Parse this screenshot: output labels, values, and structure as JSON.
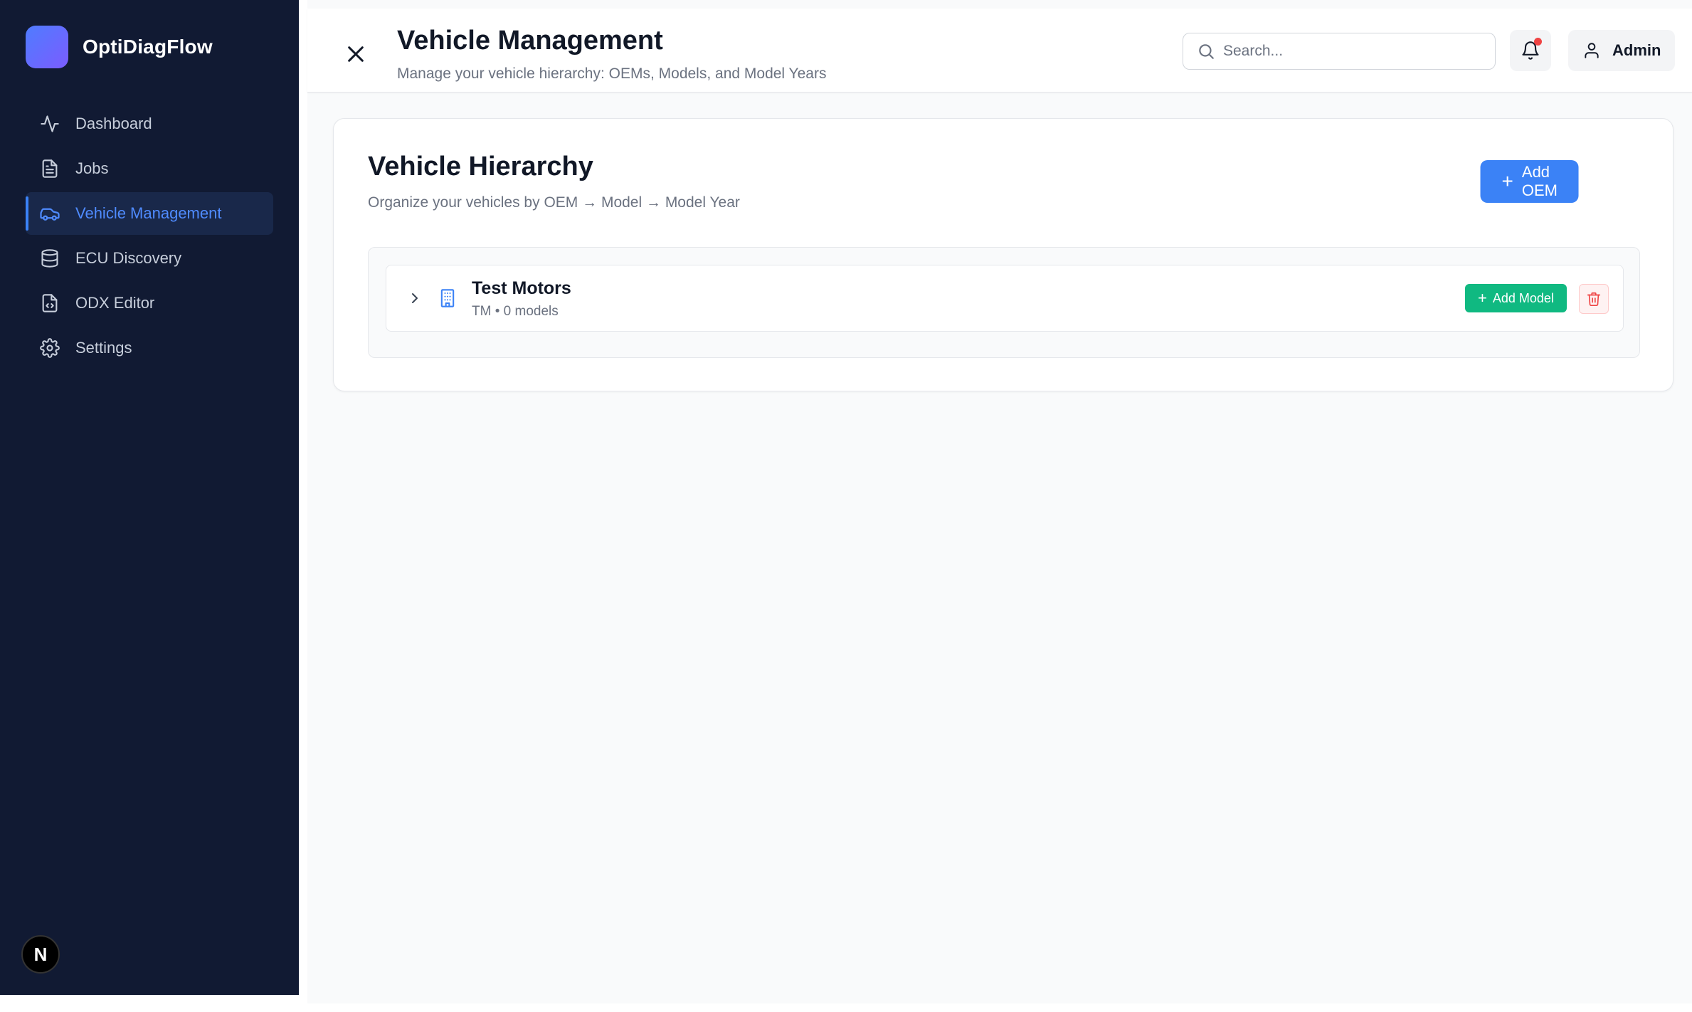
{
  "app": {
    "name": "OptiDiagFlow"
  },
  "sidebar": {
    "items": [
      {
        "label": "Dashboard",
        "icon": "activity-icon",
        "active": false
      },
      {
        "label": "Jobs",
        "icon": "file-text-icon",
        "active": false
      },
      {
        "label": "Vehicle Management",
        "icon": "car-icon",
        "active": true
      },
      {
        "label": "ECU Discovery",
        "icon": "database-icon",
        "active": false
      },
      {
        "label": "ODX Editor",
        "icon": "file-code-icon",
        "active": false
      },
      {
        "label": "Settings",
        "icon": "gear-icon",
        "active": false
      }
    ],
    "footer_badge": "N"
  },
  "header": {
    "title": "Vehicle Management",
    "subtitle": "Manage your vehicle hierarchy: OEMs, Models, and Model Years",
    "search_placeholder": "Search...",
    "user_label": "Admin",
    "has_notification": true
  },
  "hierarchy": {
    "title": "Vehicle Hierarchy",
    "subtitle": "Organize your vehicles by OEM → Model → Model Year",
    "add_oem_label": "Add OEM",
    "oems": [
      {
        "name": "Test Motors",
        "meta": "TM • 0 models",
        "add_model_label": "Add Model"
      }
    ]
  },
  "colors": {
    "sidebar_bg": "#111a33",
    "accent": "#3b82f6",
    "success": "#10b981",
    "danger": "#ef4444"
  }
}
